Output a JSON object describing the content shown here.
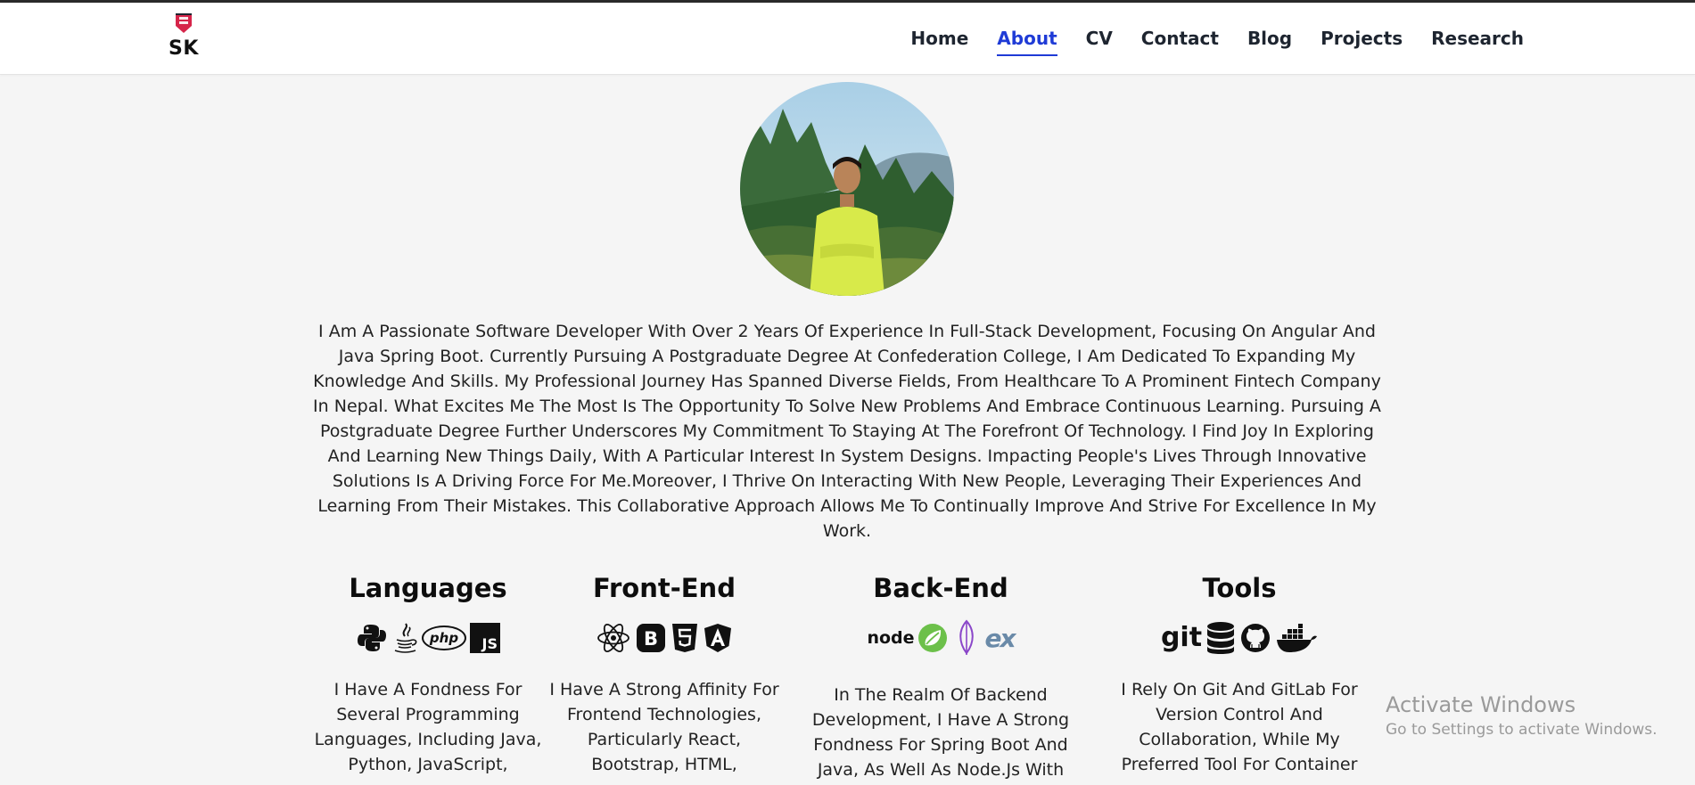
{
  "header": {
    "logo_text": "SK",
    "nav": [
      {
        "label": "Home"
      },
      {
        "label": "About"
      },
      {
        "label": "CV"
      },
      {
        "label": "Contact"
      },
      {
        "label": "Blog"
      },
      {
        "label": "Projects"
      },
      {
        "label": "Research"
      }
    ],
    "active_nav": "About"
  },
  "about": {
    "bio": "I Am A Passionate Software Developer With Over 2 Years Of Experience In Full-Stack Development, Focusing On Angular And Java Spring Boot. Currently Pursuing A Postgraduate Degree At Confederation College, I Am Dedicated To Expanding My Knowledge And Skills. My Professional Journey Has Spanned Diverse Fields, From Healthcare To A Prominent Fintech Company In Nepal. What Excites Me The Most Is The Opportunity To Solve New Problems And Embrace Continuous Learning. Pursuing A Postgraduate Degree Further Underscores My Commitment To Staying At The Forefront Of Technology. I Find Joy In Exploring And Learning New Things Daily, With A Particular Interest In System Designs. Impacting People's Lives Through Innovative Solutions Is A Driving Force For Me.Moreover, I Thrive On Interacting With New People, Leveraging Their Experiences And Learning From Their Mistakes. This Collaborative Approach Allows Me To Continually Improve And Strive For Excellence In My Work."
  },
  "skills": [
    {
      "title": "Languages",
      "icons": [
        "python-icon",
        "java-icon",
        "php-icon",
        "javascript-icon"
      ],
      "php_text": "php",
      "js_text": "JS",
      "description": "I Have A Fondness For Several Programming Languages, Including Java, Python, JavaScript,"
    },
    {
      "title": "Front-End",
      "icons": [
        "react-icon",
        "bootstrap-icon",
        "html5-icon",
        "angular-icon"
      ],
      "description": "I Have A Strong Affinity For Frontend Technologies, Particularly React, Bootstrap, HTML,"
    },
    {
      "title": "Back-End",
      "icons": [
        "nodejs-icon",
        "spring-icon",
        "mongodb-icon",
        "express-icon"
      ],
      "node_text": "node",
      "ex_text": "ex",
      "description": "In The Realm Of Backend Development, I Have A Strong Fondness For Spring Boot And Java, As Well As Node.Js With"
    },
    {
      "title": "Tools",
      "icons": [
        "git-icon",
        "database-icon",
        "github-icon",
        "docker-icon"
      ],
      "git_text": "git",
      "description": "I Rely On Git And GitLab For Version Control And Collaboration, While My Preferred Tool For Container"
    }
  ],
  "watermark": {
    "line1": "Activate Windows",
    "line2": "Go to Settings to activate Windows."
  },
  "colors": {
    "accent": "#1f3bd6",
    "background": "#f5f5f5",
    "logo_red": "#d6254a"
  }
}
